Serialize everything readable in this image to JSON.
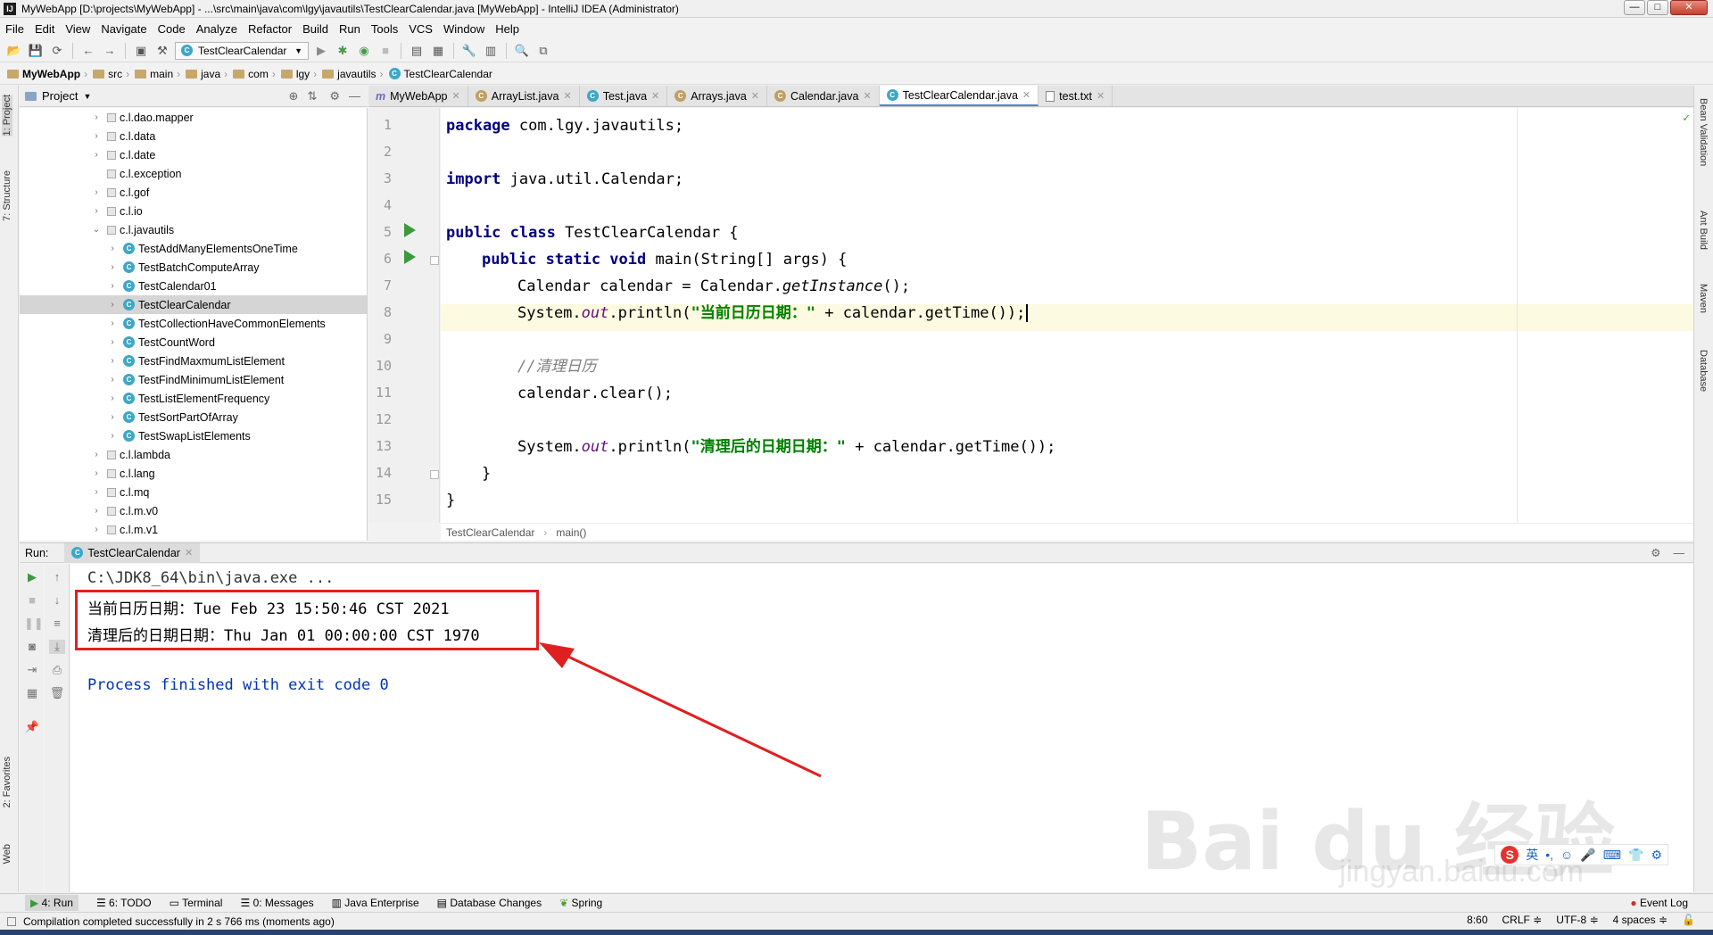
{
  "window": {
    "title": "MyWebApp [D:\\projects\\MyWebApp] - ...\\src\\main\\java\\com\\lgy\\javautils\\TestClearCalendar.java [MyWebApp] - IntelliJ IDEA (Administrator)",
    "minimize": "—",
    "maximize": "□",
    "close": "✕"
  },
  "menu": [
    "File",
    "Edit",
    "View",
    "Navigate",
    "Code",
    "Analyze",
    "Refactor",
    "Build",
    "Run",
    "Tools",
    "VCS",
    "Window",
    "Help"
  ],
  "toolbar": {
    "run_config": "TestClearCalendar"
  },
  "breadcrumbs": [
    "MyWebApp",
    "src",
    "main",
    "java",
    "com",
    "lgy",
    "javautils",
    "TestClearCalendar"
  ],
  "left_strip": {
    "project": "1: Project",
    "structure": "7: Structure",
    "favorites": "2: Favorites",
    "web": "Web"
  },
  "right_strip": {
    "bean": "Bean Validation",
    "ant": "Ant Build",
    "maven": "Maven",
    "database": "Database"
  },
  "project_panel": {
    "title": "Project",
    "items": [
      {
        "label": "c.l.dao.mapper",
        "level": 0,
        "expanded": false,
        "type": "pkg"
      },
      {
        "label": "c.l.data",
        "level": 0,
        "expanded": false,
        "type": "pkg"
      },
      {
        "label": "c.l.date",
        "level": 0,
        "expanded": false,
        "type": "pkg"
      },
      {
        "label": "c.l.exception",
        "level": 0,
        "expanded": null,
        "type": "pkg"
      },
      {
        "label": "c.l.gof",
        "level": 0,
        "expanded": false,
        "type": "pkg"
      },
      {
        "label": "c.l.io",
        "level": 0,
        "expanded": false,
        "type": "pkg"
      },
      {
        "label": "c.l.javautils",
        "level": 0,
        "expanded": true,
        "type": "pkg"
      },
      {
        "label": "TestAddManyElementsOneTime",
        "level": 1,
        "expanded": false,
        "type": "class"
      },
      {
        "label": "TestBatchComputeArray",
        "level": 1,
        "expanded": false,
        "type": "class"
      },
      {
        "label": "TestCalendar01",
        "level": 1,
        "expanded": false,
        "type": "class"
      },
      {
        "label": "TestClearCalendar",
        "level": 1,
        "expanded": false,
        "type": "class",
        "selected": true
      },
      {
        "label": "TestCollectionHaveCommonElements",
        "level": 1,
        "expanded": false,
        "type": "class"
      },
      {
        "label": "TestCountWord",
        "level": 1,
        "expanded": false,
        "type": "class"
      },
      {
        "label": "TestFindMaxmumListElement",
        "level": 1,
        "expanded": false,
        "type": "class"
      },
      {
        "label": "TestFindMinimumListElement",
        "level": 1,
        "expanded": false,
        "type": "class"
      },
      {
        "label": "TestListElementFrequency",
        "level": 1,
        "expanded": false,
        "type": "class"
      },
      {
        "label": "TestSortPartOfArray",
        "level": 1,
        "expanded": false,
        "type": "class"
      },
      {
        "label": "TestSwapListElements",
        "level": 1,
        "expanded": false,
        "type": "class"
      },
      {
        "label": "c.l.lambda",
        "level": 0,
        "expanded": false,
        "type": "pkg"
      },
      {
        "label": "c.l.lang",
        "level": 0,
        "expanded": false,
        "type": "pkg"
      },
      {
        "label": "c.l.mq",
        "level": 0,
        "expanded": false,
        "type": "pkg"
      },
      {
        "label": "c.l.m.v0",
        "level": 0,
        "expanded": false,
        "type": "pkg"
      },
      {
        "label": "c.l.m.v1",
        "level": 0,
        "expanded": false,
        "type": "pkg"
      }
    ]
  },
  "editor_tabs": [
    {
      "label": "MyWebApp",
      "active": false
    },
    {
      "label": "ArrayList.java",
      "active": false
    },
    {
      "label": "Test.java",
      "active": false
    },
    {
      "label": "Arrays.java",
      "active": false
    },
    {
      "label": "Calendar.java",
      "active": false
    },
    {
      "label": "TestClearCalendar.java",
      "active": true
    },
    {
      "label": "test.txt",
      "active": false
    }
  ],
  "code": {
    "line_numbers": [
      "1",
      "2",
      "3",
      "4",
      "5",
      "6",
      "7",
      "8",
      "9",
      "10",
      "11",
      "12",
      "13",
      "14",
      "15"
    ],
    "l1_kw": "package",
    "l1_rest": " com.lgy.javautils;",
    "l3_kw": "import",
    "l3_rest": " java.util.Calendar;",
    "l5_kw": "public class",
    "l5_rest": " TestClearCalendar {",
    "l6_kw": "public static void",
    "l6_rest": " main(String[] args) {",
    "l7_a": "Calendar calendar = Calendar.",
    "l7_b": "getInstance",
    "l7_c": "();",
    "l8_a": "System.",
    "l8_b": "out",
    "l8_c": ".println(",
    "l8_str": "\"当前日历日期：\"",
    "l8_d": " + calendar.getTime());",
    "l10_cmt": "//清理日历",
    "l11": "calendar.clear();",
    "l13_a": "System.",
    "l13_b": "out",
    "l13_c": ".println(",
    "l13_str": "\"清理后的日期日期：\"",
    "l13_d": " + calendar.getTime());",
    "l14": "}",
    "l15": "}"
  },
  "editor_footer": {
    "class": "TestClearCalendar",
    "method": "main()"
  },
  "run_panel": {
    "label": "Run:",
    "tab": "TestClearCalendar",
    "output": [
      "C:\\JDK8_64\\bin\\java.exe ...",
      "当前日历日期：Tue Feb 23 15:50:46 CST 2021",
      "清理后的日期日期：Thu Jan 01 00:00:00 CST 1970",
      "Process finished with exit code 0"
    ]
  },
  "bottom_tabs": [
    "4: Run",
    "6: TODO",
    "Terminal",
    "0: Messages",
    "Java Enterprise",
    "Database Changes",
    "Spring"
  ],
  "event_log": "Event Log",
  "status": {
    "message": "Compilation completed successfully in 2 s 766 ms (moments ago)",
    "position": "8:60",
    "line_sep": "CRLF ≑",
    "encoding": "UTF-8 ≑",
    "indent": "4 spaces ≑"
  },
  "watermark": {
    "brand": "Bai du 经验",
    "url": "jingyan.baidu.com"
  },
  "ime": {
    "lang": "英"
  },
  "colors": {
    "keyword": "#000080",
    "string": "#008000",
    "annotation_box": "#e02020",
    "console_blue": "#0033b3"
  }
}
